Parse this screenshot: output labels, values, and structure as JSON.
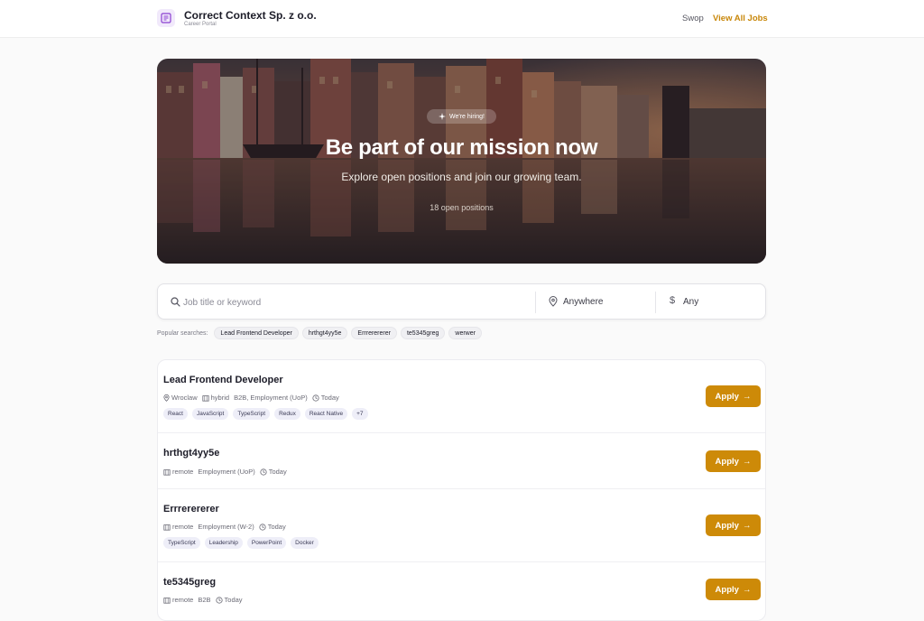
{
  "header": {
    "company": "Correct Context Sp. z o.o.",
    "subtitle": "Career Portal",
    "nav": {
      "swop": "Swop",
      "view_all": "View All Jobs"
    }
  },
  "hero": {
    "badge": "We're hiring!",
    "title": "Be part of our mission now",
    "subtitle": "Explore open positions and join our growing team.",
    "count": "18 open positions"
  },
  "search": {
    "keyword_placeholder": "Job title or keyword",
    "location": "Anywhere",
    "salary": "Any"
  },
  "popular": {
    "label": "Popular searches:",
    "items": [
      "Lead Frontend Developer",
      "hrthgt4yy5e",
      "Errrerererer",
      "te5345greg",
      "werwer"
    ]
  },
  "jobs": [
    {
      "title": "Lead Frontend Developer",
      "location": "Wroclaw",
      "work_mode": "hybrid",
      "contract": "B2B, Employment (UoP)",
      "posted": "Today",
      "tags": [
        "React",
        "JavaScript",
        "TypeScript",
        "Redux",
        "React Native",
        "+7"
      ],
      "apply": "Apply"
    },
    {
      "title": "hrthgt4yy5e",
      "work_mode": "remote",
      "contract": "Employment (UoP)",
      "posted": "Today",
      "apply": "Apply"
    },
    {
      "title": "Errrerererer",
      "work_mode": "remote",
      "contract": "Employment (W-2)",
      "posted": "Today",
      "tags": [
        "TypeScript",
        "Leadership",
        "PowerPoint",
        "Docker"
      ],
      "apply": "Apply"
    },
    {
      "title": "te5345greg",
      "work_mode": "remote",
      "contract": "B2B",
      "posted": "Today",
      "apply": "Apply"
    }
  ],
  "colors": {
    "accent": "#cd8a08",
    "nav_link": "#c8870a",
    "tag_bg": "#eeeef8"
  }
}
